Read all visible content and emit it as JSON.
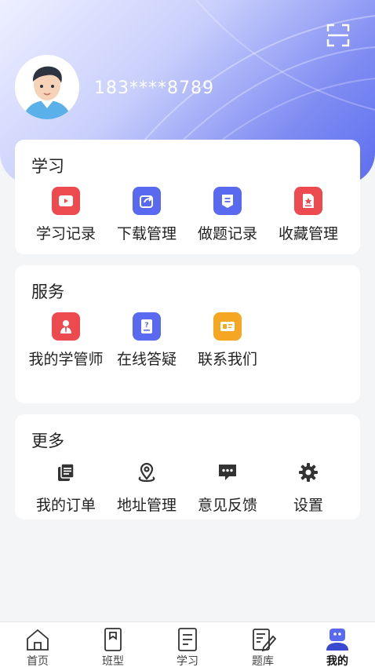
{
  "user": {
    "phone": "183****8789"
  },
  "sections": [
    {
      "title": "学习",
      "items": [
        {
          "label": "学习记录",
          "icon": "play-icon",
          "color": "#ec4a4f"
        },
        {
          "label": "下载管理",
          "icon": "share-icon",
          "color": "#5a6af0"
        },
        {
          "label": "做题记录",
          "icon": "doc-list-icon",
          "color": "#5a6af0"
        },
        {
          "label": "收藏管理",
          "icon": "star-doc-icon",
          "color": "#ec4a4f"
        }
      ]
    },
    {
      "title": "服务",
      "items": [
        {
          "label": "我的学管师",
          "icon": "teacher-icon",
          "color": "#ec4a4f"
        },
        {
          "label": "在线答疑",
          "icon": "question-icon",
          "color": "#5a6af0"
        },
        {
          "label": "联系我们",
          "icon": "contact-icon",
          "color": "#f5a623"
        }
      ]
    },
    {
      "title": "更多",
      "items": [
        {
          "label": "我的订单",
          "icon": "order-icon",
          "color": "#333333"
        },
        {
          "label": "地址管理",
          "icon": "location-icon",
          "color": "#333333"
        },
        {
          "label": "意见反馈",
          "icon": "feedback-icon",
          "color": "#333333"
        },
        {
          "label": "设置",
          "icon": "gear-icon",
          "color": "#333333"
        }
      ]
    }
  ],
  "tabs": [
    {
      "label": "首页",
      "icon": "home-icon"
    },
    {
      "label": "班型",
      "icon": "book-icon"
    },
    {
      "label": "学习",
      "icon": "study-icon"
    },
    {
      "label": "题库",
      "icon": "edit-icon"
    },
    {
      "label": "我的",
      "icon": "profile-icon",
      "active": true
    }
  ]
}
